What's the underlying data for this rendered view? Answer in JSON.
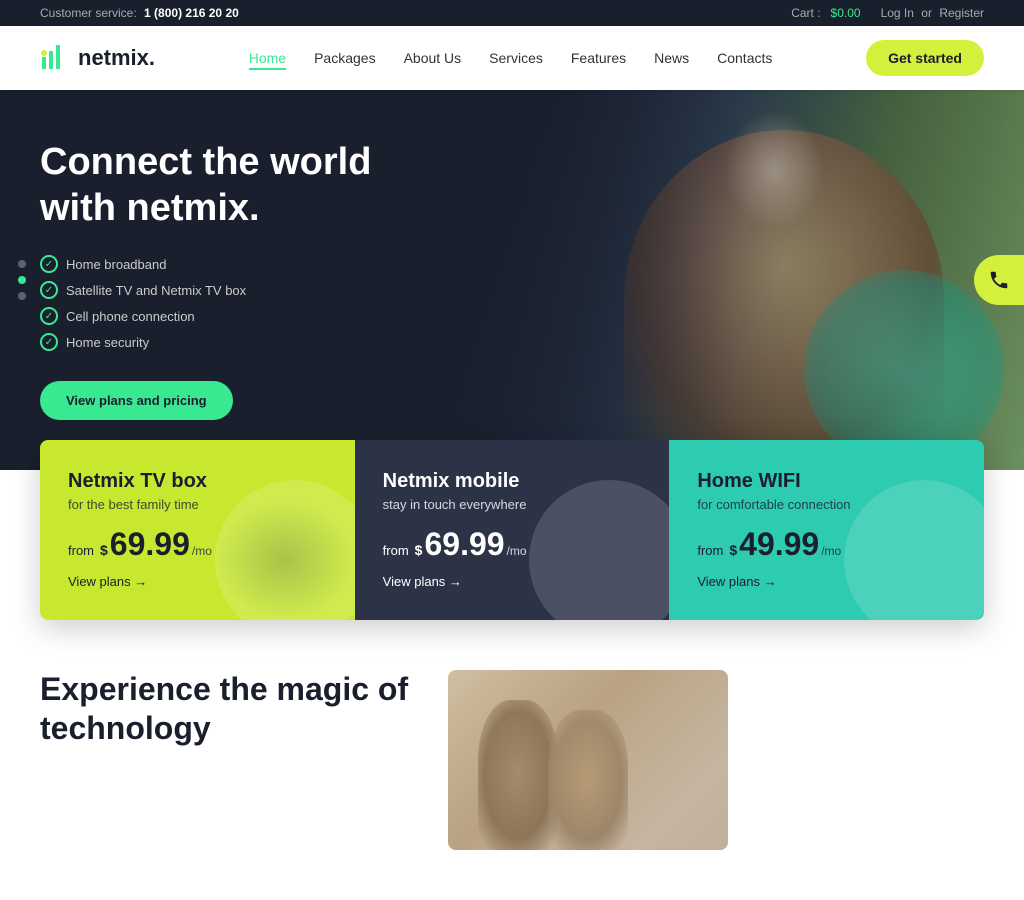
{
  "topbar": {
    "customer_service_label": "Customer service:",
    "phone": "1 (800) 216 20 20",
    "cart_label": "Cart :",
    "cart_amount": "$0.00",
    "login_label": "Log In",
    "or_text": "or",
    "register_label": "Register"
  },
  "header": {
    "logo_text": "netmix.",
    "nav": {
      "home": "Home",
      "packages": "Packages",
      "about_us": "About Us",
      "services": "Services",
      "features": "Features",
      "news": "News",
      "contacts": "Contacts"
    },
    "cta_button": "Get started"
  },
  "hero": {
    "heading_line1": "Connect the world",
    "heading_line2": "with netmix.",
    "features": [
      "Home broadband",
      "Satellite TV and Netmix TV box",
      "Cell phone connection",
      "Home security"
    ],
    "cta_button": "View plans and pricing",
    "phone_icon": "📞"
  },
  "plans": [
    {
      "id": "tv",
      "title": "Netmix TV box",
      "subtitle": "for the best family time",
      "price_from": "from",
      "price_dollar": "$",
      "price_amount": "69.99",
      "price_per": "/mo",
      "link_text": "View plans →",
      "theme": "yellow"
    },
    {
      "id": "mobile",
      "title": "Netmix mobile",
      "subtitle": "stay in touch everywhere",
      "price_from": "from",
      "price_dollar": "$",
      "price_amount": "69.99",
      "price_per": "/mo",
      "link_text": "View plans →",
      "theme": "dark"
    },
    {
      "id": "wifi",
      "title": "Home WIFI",
      "subtitle": "for comfortable connection",
      "price_from": "from",
      "price_dollar": "$",
      "price_amount": "49.99",
      "price_per": "/mo",
      "link_text": "View plans →",
      "theme": "teal"
    }
  ],
  "bottom_teaser": {
    "heading_line1": "Experience the magic of",
    "heading_line2": "technology"
  },
  "colors": {
    "accent_green": "#39e991",
    "accent_yellow": "#d4f03c",
    "dark_navy": "#1a1f2e",
    "teal": "#2dcbb0",
    "plan_yellow": "#c8e830",
    "plan_dark": "#2c3347"
  }
}
